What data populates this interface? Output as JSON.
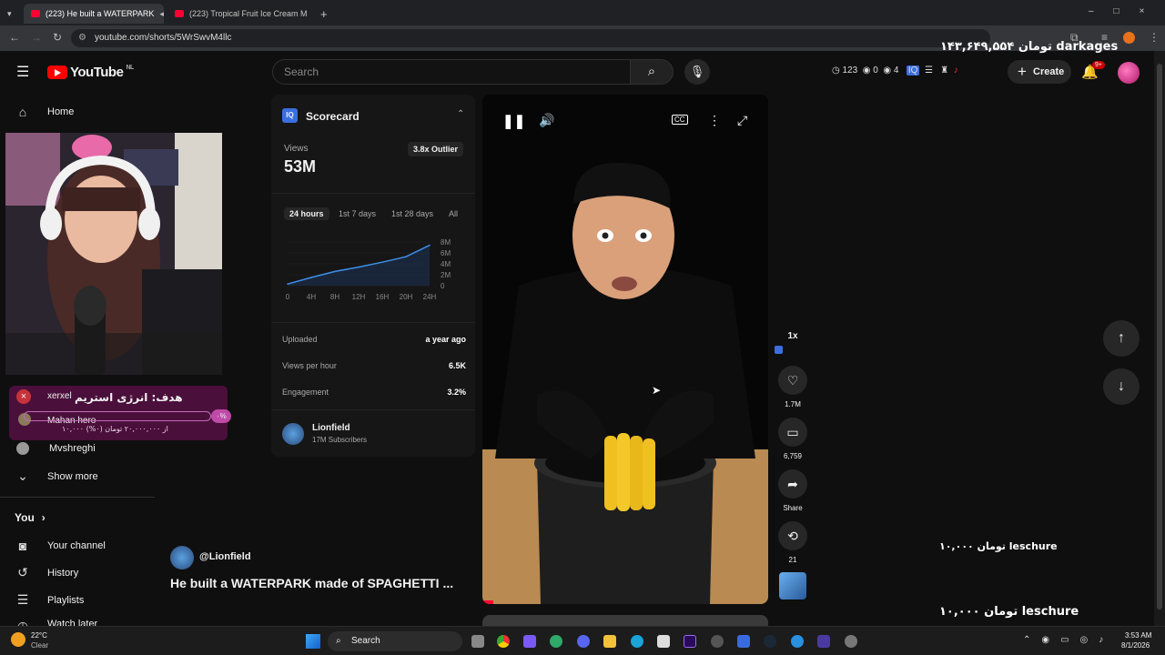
{
  "browser": {
    "tabs": [
      {
        "label": "(223) He built a WATERPARK"
      },
      {
        "label": "(223) Tropical Fruit Ice Cream M"
      }
    ],
    "url": "youtube.com/shorts/5WrSwvM4llc"
  },
  "overlays": {
    "top_right": "۱۴۳,۶۴۹,۵۵۴ تومان darkages",
    "mid_right": "۱۰,۰۰۰ تومان  leschure",
    "bottom_right": "۱۰,۰۰۰ تومان  leschure"
  },
  "header": {
    "logo": "YouTube",
    "region": "NL",
    "search_placeholder": "Search",
    "stats": {
      "views_icon_count": "123",
      "watch_count": "0",
      "eye_count": "4"
    },
    "create_label": "Create",
    "notif_badge": "9+"
  },
  "sidebar": {
    "home": "Home",
    "donation": {
      "user1": "xerxel",
      "goal": "هدف: انرژی استریم",
      "user2": "Mahan hero",
      "progress_text": "۱۰,۰۰۰ از ۲۰,۰۰۰,۰۰۰ تومان (۰%)",
      "percent_badge": "۰%"
    },
    "subscription": "Mvshreghi",
    "show_more": "Show more",
    "you": "You",
    "items": [
      "Your channel",
      "History",
      "Playlists",
      "Watch later"
    ]
  },
  "scorecard": {
    "title": "Scorecard",
    "views_label": "Views",
    "views_value": "53M",
    "outlier": "3.8x Outlier",
    "tabs": [
      "24 hours",
      "1st 7 days",
      "1st 28 days",
      "All"
    ],
    "uploaded_label": "Uploaded",
    "uploaded_value": "a year ago",
    "vph_label": "Views per hour",
    "vph_value": "6.5K",
    "engagement_label": "Engagement",
    "engagement_value": "3.2%",
    "channel_name": "Lionfield",
    "channel_subs": "17M Subscribers"
  },
  "chart_data": {
    "type": "line",
    "x": [
      "0",
      "4H",
      "8H",
      "12H",
      "16H",
      "20H",
      "24H"
    ],
    "series": [
      {
        "values": [
          0.3,
          1.5,
          2.6,
          3.4,
          4.3,
          5.3,
          7.4
        ]
      }
    ],
    "yticks": [
      "8M",
      "6M",
      "4M",
      "2M",
      "0"
    ],
    "ylim": [
      0,
      8
    ]
  },
  "video": {
    "channel": "@Lionfield",
    "title": "He built a WATERPARK made of SPAGHETTI ..."
  },
  "actions": {
    "speed": "1x",
    "likes": "1.7M",
    "comments": "6,759",
    "share": "Share",
    "remix": "21"
  },
  "taskbar": {
    "weather_temp": "22°C",
    "weather_desc": "Clear",
    "search": "Search",
    "time": "3:53 AM",
    "date": "8/1/2026"
  }
}
